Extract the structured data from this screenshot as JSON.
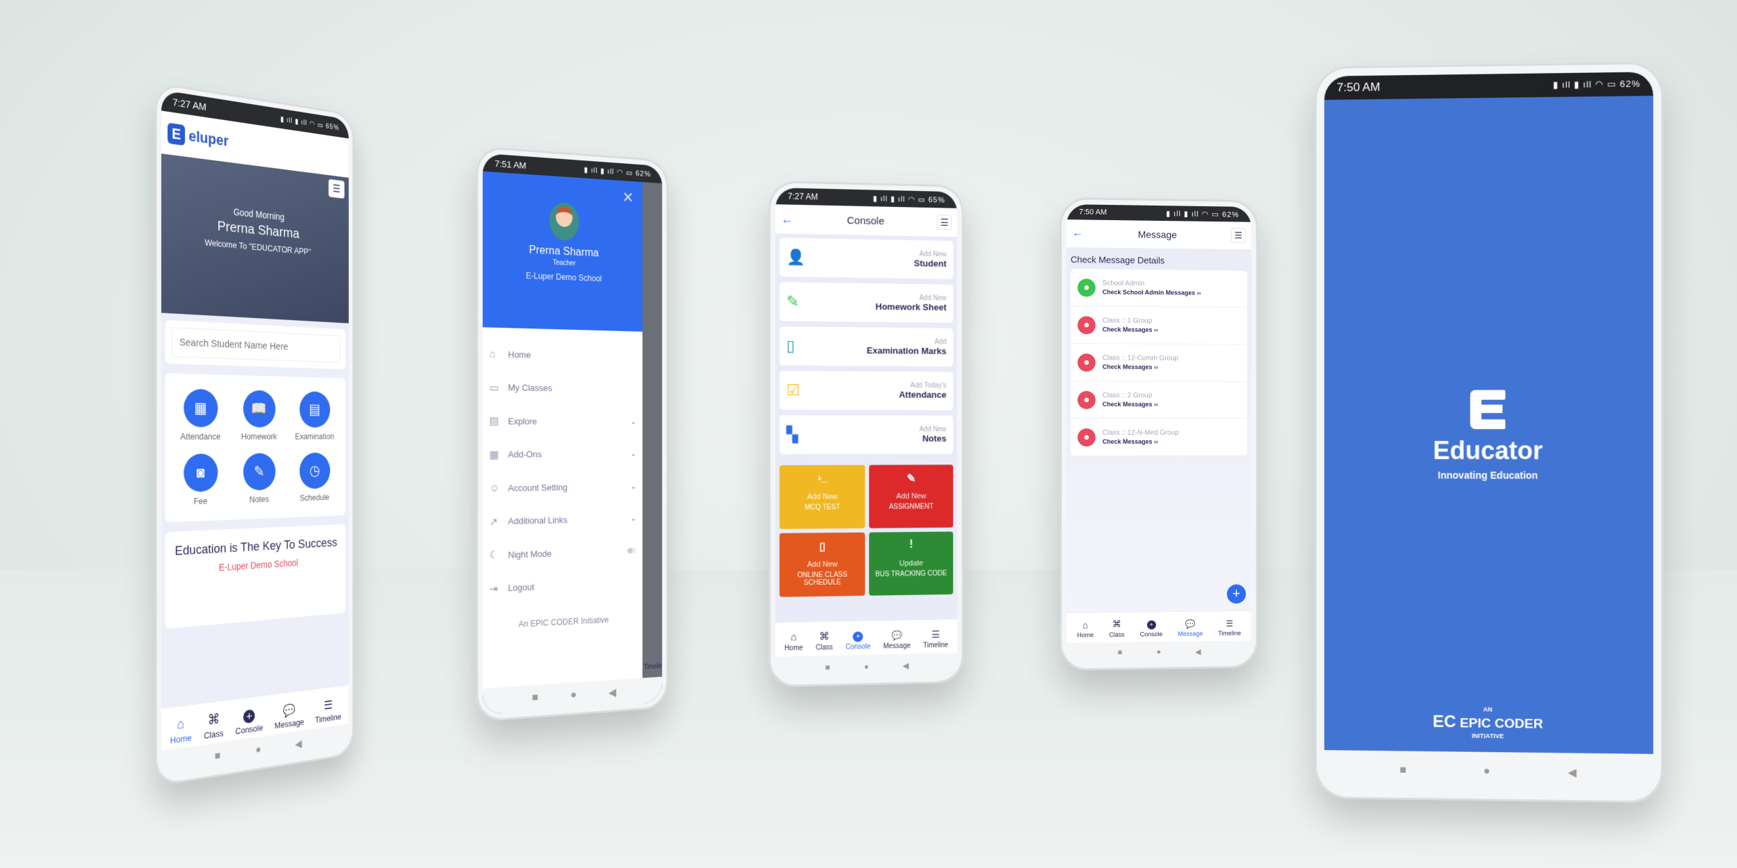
{
  "colors": {
    "primary": "#2f6cf0",
    "navy": "#2d2b5a",
    "red": "#e84a5f",
    "splash": "#4274d4"
  },
  "home": {
    "time": "7:27 AM",
    "battery": "65%",
    "logo": "eluper",
    "greeting": "Good Morning",
    "user": "Prerna Sharma",
    "welcome": "Welcome To \"EDUCATOR APP\"",
    "search_placeholder": "Search Student Name Here",
    "tiles": [
      {
        "label": "Attendance",
        "icon": "calendar-icon"
      },
      {
        "label": "Homework",
        "icon": "book-icon"
      },
      {
        "label": "Examination",
        "icon": "clipboard-chart-icon"
      },
      {
        "label": "Fee",
        "icon": "money-icon"
      },
      {
        "label": "Notes",
        "icon": "pencil-icon"
      },
      {
        "label": "Schedule",
        "icon": "clock-icon"
      }
    ],
    "quote": "Education is The Key To Success",
    "school": "E-Luper Demo School"
  },
  "nav": [
    {
      "label": "Home",
      "icon": "home-icon"
    },
    {
      "label": "Class",
      "icon": "command-icon"
    },
    {
      "label": "Console",
      "icon": "plus-circle-icon"
    },
    {
      "label": "Message",
      "icon": "chat-icon"
    },
    {
      "label": "Timeline",
      "icon": "timeline-icon"
    }
  ],
  "drawer": {
    "time": "7:51 AM",
    "battery": "62%",
    "name": "Prerna Sharma",
    "role": "Teacher",
    "school": "E-Luper Demo School",
    "items": [
      {
        "label": "Home",
        "icon": "home-icon",
        "expand": false
      },
      {
        "label": "My Classes",
        "icon": "briefcase-icon",
        "expand": false
      },
      {
        "label": "Explore",
        "icon": "news-icon",
        "expand": true
      },
      {
        "label": "Add-Ons",
        "icon": "grid-icon",
        "expand": true
      },
      {
        "label": "Account Setting",
        "icon": "user-settings-icon",
        "expand": true
      },
      {
        "label": "Additional Links",
        "icon": "external-link-icon",
        "expand": true
      },
      {
        "label": "Night Mode",
        "icon": "moon-icon",
        "toggle": false
      },
      {
        "label": "Logout",
        "icon": "logout-icon",
        "expand": false
      }
    ],
    "footer": "An EPIC CODER Initiative",
    "behind_tab": "Timeline"
  },
  "console": {
    "time": "7:27 AM",
    "battery": "65%",
    "title": "Console",
    "rows": [
      {
        "sub": "Add New",
        "label": "Student",
        "icon": "user-plus-icon",
        "color": "#e84a5f"
      },
      {
        "sub": "Add New",
        "label": "Homework Sheet",
        "icon": "pencil-icon",
        "color": "#3cc452"
      },
      {
        "sub": "Add",
        "label": "Examination Marks",
        "icon": "id-card-icon",
        "color": "#2a8fbf"
      },
      {
        "sub": "Add Today's",
        "label": "Attendance",
        "icon": "calendar-check-icon",
        "color": "#f0c02a"
      },
      {
        "sub": "Add New",
        "label": "Notes",
        "icon": "layout-icon",
        "color": "#2f6cf0"
      }
    ],
    "cards": [
      {
        "sub": "Add New",
        "label": "MCQ TEST",
        "icon": "terminal-icon",
        "color": "#f0b823"
      },
      {
        "sub": "Add New",
        "label": "ASSIGNMENT",
        "icon": "edit-icon",
        "color": "#dc2a2a"
      },
      {
        "sub": "Add New",
        "label": "ONLINE CLASS SCHEDULE",
        "icon": "phone-icon",
        "color": "#e3581f"
      },
      {
        "sub": "Update",
        "label": "BUS TRACKING CODE",
        "icon": "alert-badge-icon",
        "color": "#2e8b35"
      }
    ]
  },
  "message": {
    "time": "7:50 AM",
    "battery": "62%",
    "title": "Message",
    "heading": "Check Message Details",
    "items": [
      {
        "title": "School Admin",
        "link": "Check School Admin Messages ››",
        "color": "#3cc452"
      },
      {
        "title": "Class :: 1 Group",
        "link": "Check Messages ››",
        "color": "#e84a5f"
      },
      {
        "title": "Class :: 12-Comm Group",
        "link": "Check Messages ››",
        "color": "#e84a5f"
      },
      {
        "title": "Class :: 2 Group",
        "link": "Check Messages ››",
        "color": "#e84a5f"
      },
      {
        "title": "Class :: 12-N-Med Group",
        "link": "Check Messages ››",
        "color": "#e84a5f"
      }
    ]
  },
  "splash": {
    "time": "7:50 AM",
    "battery": "62%",
    "app": "Educator",
    "tagline": "Innovating Education",
    "an": "AN",
    "brand": "EPIC CODER",
    "initiative": "INITIATIVE"
  }
}
